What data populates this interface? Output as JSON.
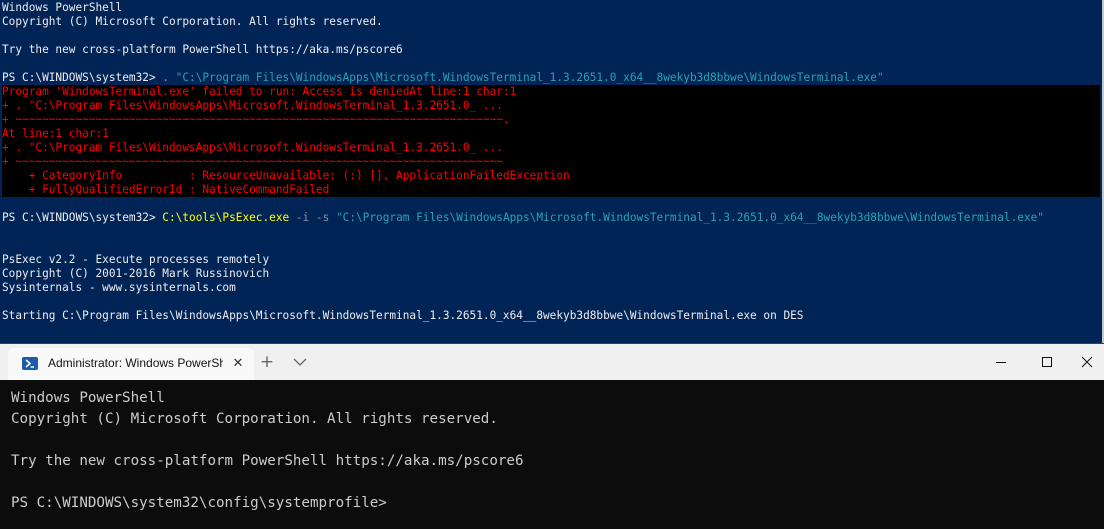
{
  "bg_window": {
    "lines": [
      {
        "text": "Windows PowerShell",
        "kind": "normal"
      },
      {
        "text": "Copyright (C) Microsoft Corporation. All rights reserved.",
        "kind": "normal"
      },
      {
        "text": "",
        "kind": "normal"
      },
      {
        "text": "Try the new cross-platform PowerShell https://aka.ms/pscore6",
        "kind": "normal"
      },
      {
        "text": "",
        "kind": "normal"
      },
      {
        "text": "PS C:\\WINDOWS\\system32> . \"C:\\Program Files\\WindowsApps\\Microsoft.WindowsTerminal_1.3.2651.0_x64__8wekyb3d8bbwe\\WindowsTerminal.exe\"",
        "kind": "cmd1"
      },
      {
        "text": "Program 'WindowsTerminal.exe' failed to run: Access is deniedAt line:1 char:1",
        "kind": "error"
      },
      {
        "text": "+ . \"C:\\Program Files\\WindowsApps\\Microsoft.WindowsTerminal_1.3.2651.0_ ...",
        "kind": "error"
      },
      {
        "text": "+ ~~~~~~~~~~~~~~~~~~~~~~~~~~~~~~~~~~~~~~~~~~~~~~~~~~~~~~~~~~~~~~~~~~~~~~~~~.",
        "kind": "error"
      },
      {
        "text": "At line:1 char:1",
        "kind": "error"
      },
      {
        "text": "+ . \"C:\\Program Files\\WindowsApps\\Microsoft.WindowsTerminal_1.3.2651.0_ ...",
        "kind": "error"
      },
      {
        "text": "+ ~~~~~~~~~~~~~~~~~~~~~~~~~~~~~~~~~~~~~~~~~~~~~~~~~~~~~~~~~~~~~~~~~~~~~~~~~",
        "kind": "error"
      },
      {
        "text": "    + CategoryInfo          : ResourceUnavailable: (:) [], ApplicationFailedException",
        "kind": "error"
      },
      {
        "text": "    + FullyQualifiedErrorId : NativeCommandFailed",
        "kind": "error"
      },
      {
        "text": "",
        "kind": "normal"
      },
      {
        "text": "PS C:\\WINDOWS\\system32> C:\\tools\\PsExec.exe -i -s \"C:\\Program Files\\WindowsApps\\Microsoft.WindowsTerminal_1.3.2651.0_x64__8wekyb3d8bbwe\\WindowsTerminal.exe\"",
        "kind": "cmd2"
      },
      {
        "text": "",
        "kind": "normal"
      },
      {
        "text": "",
        "kind": "normal"
      },
      {
        "text": "PsExec v2.2 - Execute processes remotely",
        "kind": "normal"
      },
      {
        "text": "Copyright (C) 2001-2016 Mark Russinovich",
        "kind": "normal"
      },
      {
        "text": "Sysinternals - www.sysinternals.com",
        "kind": "normal"
      },
      {
        "text": "",
        "kind": "normal"
      },
      {
        "text": "Starting C:\\Program Files\\WindowsApps\\Microsoft.WindowsTerminal_1.3.2651.0_x64__8wekyb3d8bbwe\\WindowsTerminal.exe on DES",
        "kind": "normal"
      }
    ],
    "cmd1": {
      "prompt": "PS C:\\WINDOWS\\system32> ",
      "operator": ". ",
      "path": "\"C:\\Program Files\\WindowsApps\\Microsoft.WindowsTerminal_1.3.2651.0_x64__8wekyb3d8bbwe\\WindowsTerminal.exe\""
    },
    "cmd2": {
      "prompt": "PS C:\\WINDOWS\\system32> ",
      "exe": "C:\\tools\\PsExec.exe",
      "args": " -i -s ",
      "path": "\"C:\\Program Files\\WindowsApps\\Microsoft.WindowsTerminal_1.3.2651.0_x64__8wekyb3d8bbwe\\WindowsTerminal.exe\""
    }
  },
  "terminal": {
    "tab_title": "Administrator: Windows PowerShell",
    "tab_icon": "powershell-icon",
    "close_tab_glyph": "✕",
    "new_tab_glyph": "+",
    "lines": [
      "Windows PowerShell",
      "Copyright (C) Microsoft Corporation. All rights reserved.",
      "",
      "Try the new cross-platform PowerShell https://aka.ms/pscore6",
      "",
      "PS C:\\WINDOWS\\system32\\config\\systemprofile>"
    ]
  },
  "colors": {
    "ps_background": "#012456",
    "ps_text": "#eeedf0",
    "error_text": "#ff0000",
    "error_background": "#000000",
    "command_yellow": "#ffff00",
    "string_cyan": "#2aa1b3",
    "terminal_background": "#0c0c0c",
    "terminal_text": "#cccccc"
  }
}
